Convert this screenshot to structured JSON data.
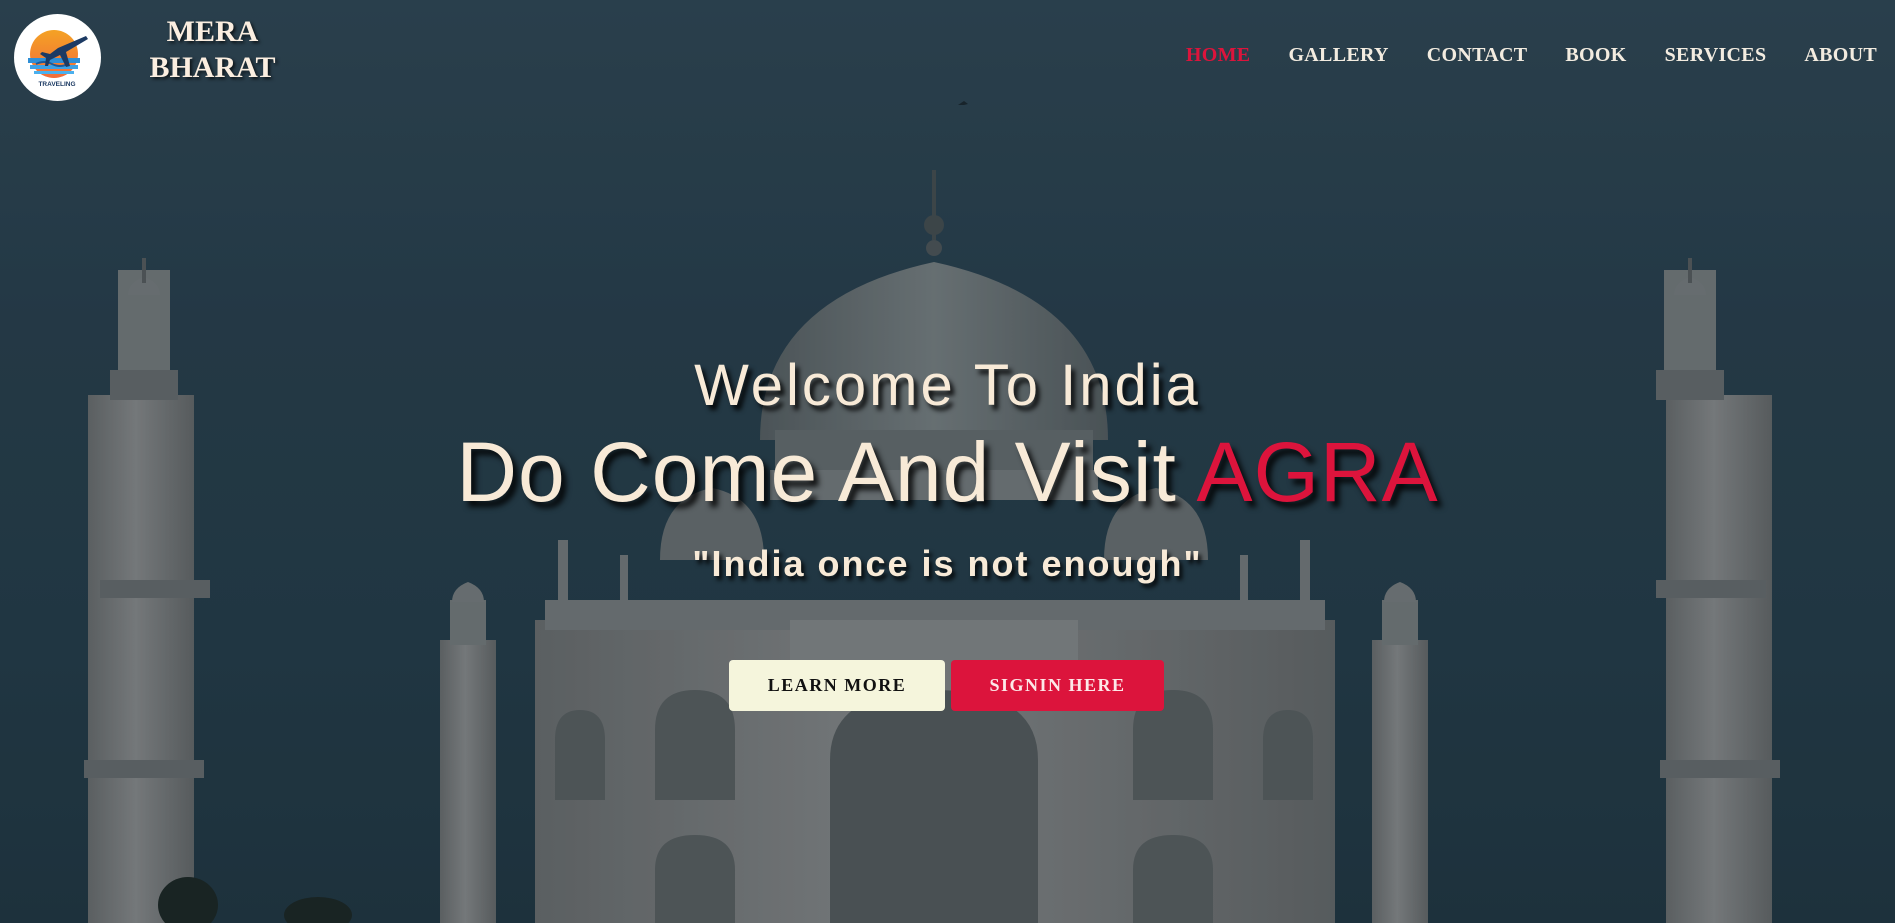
{
  "header": {
    "logo": {
      "icon": "airplane-sunset-icon",
      "caption": "TRAVELING"
    },
    "brand_line1": "MERA",
    "brand_line2": "BHARAT",
    "nav": [
      {
        "label": "HOME",
        "active": true
      },
      {
        "label": "GALLERY",
        "active": false
      },
      {
        "label": "CONTACT",
        "active": false
      },
      {
        "label": "BOOK",
        "active": false
      },
      {
        "label": "SERVICES",
        "active": false
      },
      {
        "label": "ABOUT",
        "active": false
      }
    ]
  },
  "hero": {
    "welcome": "Welcome To India",
    "headline_prefix": "Do Come And Visit ",
    "headline_accent": "AGRA",
    "tagline": "\"India once is not enough\"",
    "learn_more_label": "LEARN MORE",
    "signin_label": "SIGNIN HERE"
  },
  "colors": {
    "accent": "#dc143c",
    "text_light": "#f8ead7",
    "learn_more_bg": "#f5f5dc",
    "sky": "#2c4350"
  }
}
